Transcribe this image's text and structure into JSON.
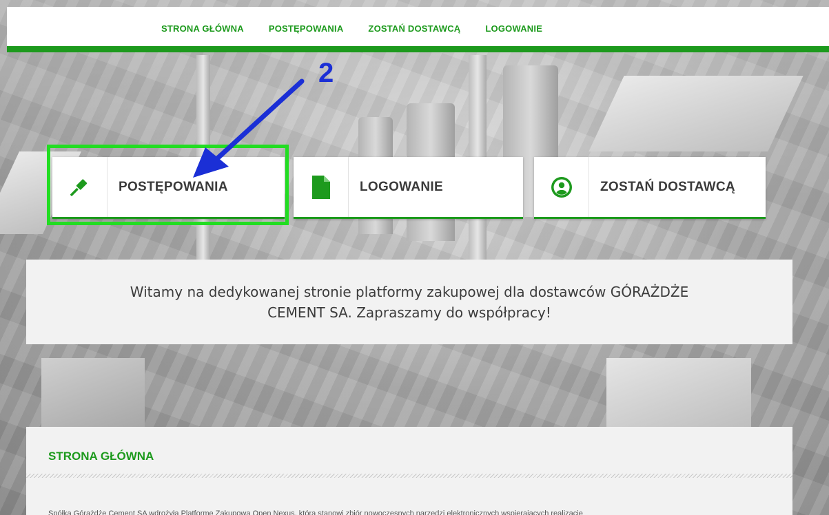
{
  "topnav": {
    "items": [
      "STRONA GŁÓWNA",
      "POSTĘPOWANIA",
      "ZOSTAŃ DOSTAWCĄ",
      "LOGOWANIE"
    ]
  },
  "annotation": {
    "step_number": "2",
    "color": "#1b2fd6",
    "highlight_color": "#22dd22"
  },
  "tiles": [
    {
      "label": "POSTĘPOWANIA",
      "icon": "gavel-icon"
    },
    {
      "label": "LOGOWANIE",
      "icon": "document-icon"
    },
    {
      "label": "ZOSTAŃ DOSTAWCĄ",
      "icon": "user-circle-icon"
    }
  ],
  "welcome": {
    "text": "Witamy na dedykowanej stronie platformy zakupowej dla dostawców GÓRAŻDŻE CEMENT SA. Zapraszamy do współpracy!"
  },
  "content": {
    "title": "STRONA GŁÓWNA",
    "body": "Spółka Górażdże Cement SA wdrożyła Platformę Zakupową Open Nexus, która stanowi zbiór nowoczesnych narzędzi elektronicznych wspierających realizację"
  },
  "colors": {
    "accent": "#1d9a1d",
    "panel": "#f2f2f2",
    "text": "#3c3c3c"
  }
}
